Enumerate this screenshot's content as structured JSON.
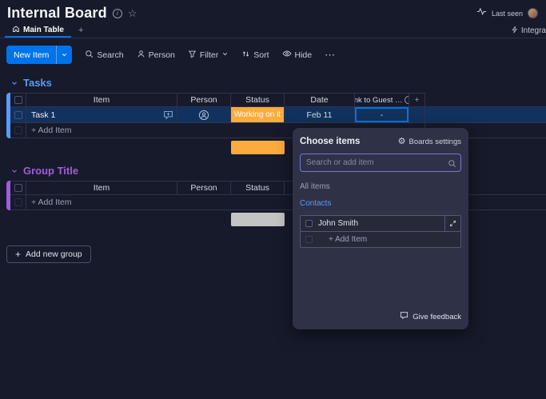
{
  "colors": {
    "accent_blue": "#0073ea",
    "tasks_group_color": "#579bfc",
    "second_group_color": "#a25ddc",
    "status_working_on_it": "#fdab3d",
    "second_group_summary": "#c4c4c4",
    "selected_row_bg": "#10325c"
  },
  "glyphs": {
    "plus": "+",
    "star": "☆",
    "gear": "⚙",
    "info": "i"
  },
  "header": {
    "title": "Internal Board",
    "last_seen_label": "Last seen"
  },
  "tab_bar": {
    "main_tab": "Main Table",
    "integrate_label": "Integra"
  },
  "toolbar": {
    "new_item": "New Item",
    "search": "Search",
    "person": "Person",
    "filter": "Filter",
    "sort": "Sort",
    "hide": "Hide",
    "more": "⋯"
  },
  "table_columns": {
    "item": "Item",
    "person": "Person",
    "status": "Status",
    "date": "Date",
    "link": "link to Guest …",
    "add_column": "+"
  },
  "groups": {
    "tasks": {
      "title": "Tasks",
      "add_item": "+ Add Item",
      "row": {
        "item": "Task 1",
        "status": "Working on it",
        "date": "Feb 11",
        "link_value": "-"
      }
    },
    "second": {
      "title": "Group Title",
      "add_item": "+ Add Item"
    }
  },
  "add_new_group_label": "Add new group",
  "popup": {
    "title": "Choose items",
    "boards_settings": "Boards settings",
    "search_placeholder": "Search or add item",
    "all_items": "All items",
    "contacts_link": "Contacts",
    "list": {
      "first_item": "John Smith",
      "add_item": "+ Add Item"
    },
    "give_feedback": "Give feedback"
  }
}
